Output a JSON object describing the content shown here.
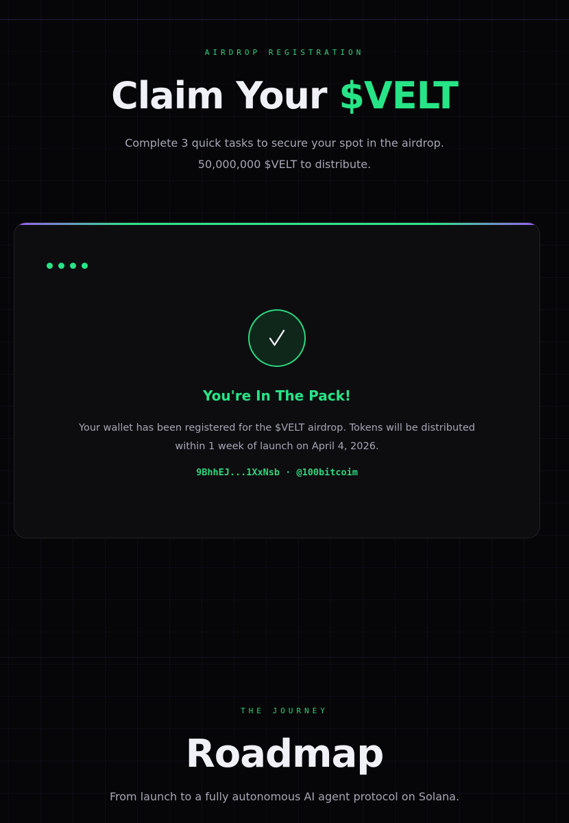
{
  "hero": {
    "eyebrow": "AIRDROP REGISTRATION",
    "title_prefix": "Claim Your ",
    "title_accent": "$VELT",
    "subtitle_line1": "Complete 3 quick tasks to secure your spot in the airdrop.",
    "subtitle_line2": "50,000,000 $VELT to distribute."
  },
  "card": {
    "steps_indicator_count": 4,
    "check_icon": "check-icon",
    "check_glyph": "✓",
    "success_title": "You're In The Pack!",
    "success_desc_line1": "Your wallet has been registered for the $VELT airdrop. Tokens will be distributed",
    "success_desc_line2": "within 1 week of launch on April 4, 2026.",
    "wallet_line": "9BhhEJ...1XxNsb · @100bitcoim"
  },
  "roadmap": {
    "eyebrow": "THE JOURNEY",
    "title": "Roadmap",
    "subtitle": "From launch to a fully autonomous AI agent protocol on Solana."
  },
  "colors": {
    "accent": "#27e487",
    "background": "#060608",
    "card_bg": "#0d0d10",
    "purple": "#9b5cf6",
    "muted_text": "#a7a7b6"
  }
}
